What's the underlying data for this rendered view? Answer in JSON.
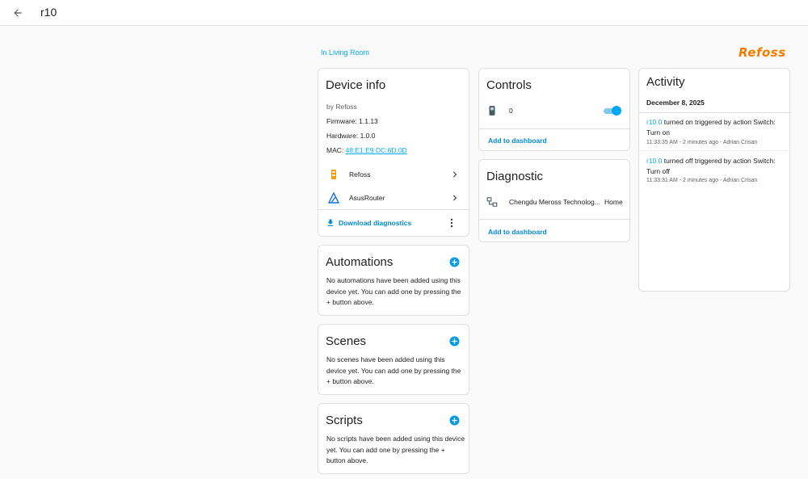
{
  "header": {
    "title": "r10"
  },
  "area": {
    "label": "In Living Room"
  },
  "brand": {
    "name": "Refoss"
  },
  "device_info": {
    "title": "Device info",
    "manufacturer": "by Refoss",
    "firmware": "Firmware: 1.1.13",
    "hardware": "Hardware: 1.0.0",
    "mac_label": "MAC:",
    "mac_value": "48:E1:E9:DC:6D:0D",
    "integrations": [
      {
        "label": "Refoss",
        "icon": "refoss-icon"
      },
      {
        "label": "AsusRouter",
        "icon": "asusrouter-icon"
      }
    ],
    "download_label": "Download diagnostics"
  },
  "controls": {
    "title": "Controls",
    "entity_label": "0",
    "entity_icon": "switch-icon",
    "switch_on": true,
    "add_label": "Add to dashboard"
  },
  "diagnostic": {
    "title": "Diagnostic",
    "entity_label": "Chengdu Meross Technolog...",
    "entity_value": "Home",
    "entity_icon": "network-icon",
    "add_label": "Add to dashboard"
  },
  "activity": {
    "title": "Activity",
    "date": "December 8, 2025",
    "entries": [
      {
        "entity": "r10 0",
        "text": " turned on triggered by action Switch: Turn on",
        "time": "11:33:35 AM - 2 minutes ago - ",
        "user": "Adrian Crisan"
      },
      {
        "entity": "r10 0",
        "text": " turned off triggered by action Switch: Turn off",
        "time": "11:33:31 AM - 2 minutes ago - ",
        "user": "Adrian Crisan"
      }
    ]
  },
  "automations": {
    "title": "Automations",
    "empty": "No automations have been added using this device yet. You can add one by pressing the + button above."
  },
  "scenes": {
    "title": "Scenes",
    "empty": "No scenes have been added using this device yet. You can add one by pressing the + button above."
  },
  "scripts": {
    "title": "Scripts",
    "empty": "No scripts have been added using this device yet. You can add one by pressing the + button above."
  },
  "colors": {
    "accent": "#03a9f4",
    "brand": "#f57c00",
    "primary_text": "#212121",
    "secondary_text": "#616161"
  }
}
